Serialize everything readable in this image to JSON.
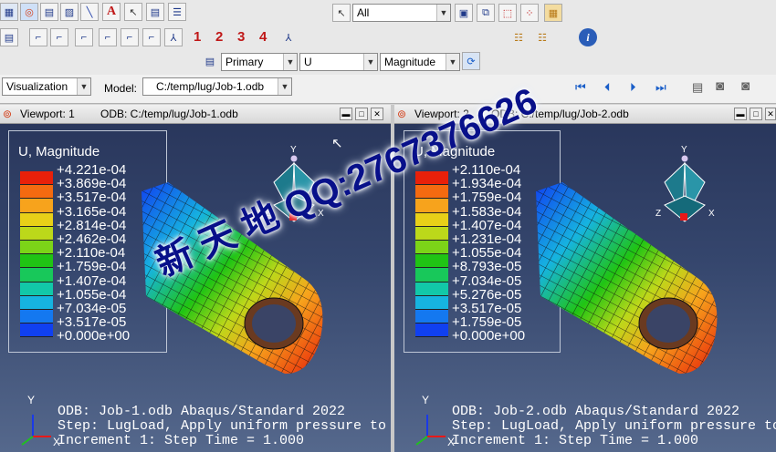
{
  "toolbar": {
    "numbers": [
      "1",
      "2",
      "3",
      "4"
    ],
    "selection_filter": "All",
    "field_output": {
      "step": "Primary",
      "variable": "U",
      "invariant": "Magnitude"
    },
    "module_label": "Visualization",
    "model_label": "Model:",
    "model_path": "C:/temp/lug/Job-1.odb"
  },
  "viewports": [
    {
      "title": "Viewport: 1",
      "odb": "ODB: C:/temp/lug/Job-1.odb",
      "legend_title": "U, Magnitude",
      "values": [
        "+4.221e-04",
        "+3.869e-04",
        "+3.517e-04",
        "+3.165e-04",
        "+2.814e-04",
        "+2.462e-04",
        "+2.110e-04",
        "+1.759e-04",
        "+1.407e-04",
        "+1.055e-04",
        "+7.034e-05",
        "+3.517e-05",
        "+0.000e+00"
      ],
      "footer": [
        "ODB: Job-1.odb    Abaqus/Standard 2022",
        "Step: LugLoad, Apply uniform pressure to th",
        "Increment      1: Step Time =    1.000"
      ]
    },
    {
      "title": "Viewport: 2",
      "odb": "ODB: C:/temp/lug/Job-2.odb",
      "legend_title": "U, Magnitude",
      "values": [
        "+2.110e-04",
        "+1.934e-04",
        "+1.759e-04",
        "+1.583e-04",
        "+1.407e-04",
        "+1.231e-04",
        "+1.055e-04",
        "+8.793e-05",
        "+7.034e-05",
        "+5.276e-05",
        "+3.517e-05",
        "+1.759e-05",
        "+0.000e+00"
      ],
      "footer": [
        "ODB: Job-2.odb    Abaqus/Standard 2022",
        "Step: LugLoad, Apply uniform pressure to th",
        "Increment      1: Step Time =    1.000"
      ]
    }
  ],
  "triad_labels": {
    "y": "Y",
    "z": "Z",
    "x": "X"
  },
  "watermark": {
    "text": "新 天 地 QQ:2767376626"
  },
  "colors": {
    "legend": [
      "#e8200a",
      "#f46a10",
      "#f7a31c",
      "#e8d018",
      "#bcd81a",
      "#7cd418",
      "#20c414",
      "#18c85a",
      "#12c8a8",
      "#16b4e0",
      "#1478f0",
      "#1040f0",
      "#0616d8"
    ]
  }
}
